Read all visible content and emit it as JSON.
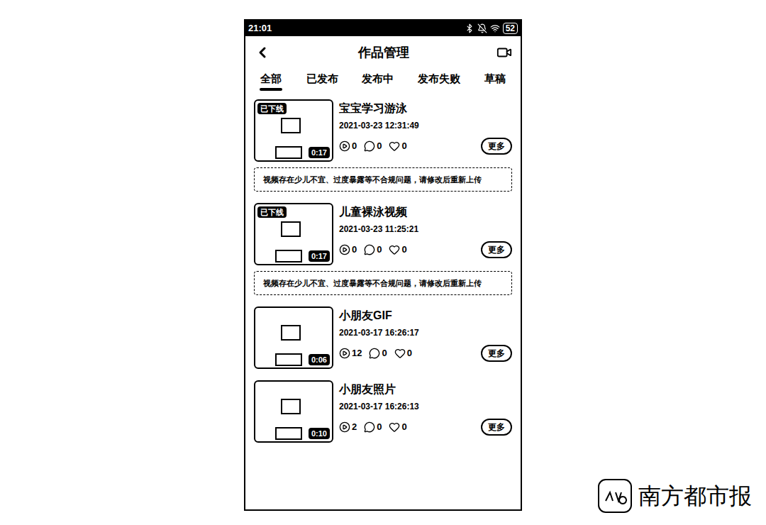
{
  "status_bar": {
    "time": "21:01",
    "battery": "52"
  },
  "header": {
    "title": "作品管理"
  },
  "tabs": [
    {
      "label": "全部",
      "selected": true
    },
    {
      "label": "已发布",
      "selected": false
    },
    {
      "label": "发布中",
      "selected": false
    },
    {
      "label": "发布失败",
      "selected": false
    },
    {
      "label": "草稿",
      "selected": false
    }
  ],
  "works": [
    {
      "title": "宝宝学习游泳",
      "date": "2021-03-23 12:31:49",
      "duration": "0:17",
      "offline": true,
      "badge": "已下线",
      "stats": {
        "plays": "0",
        "comments": "0",
        "likes": "0"
      },
      "more": "更多",
      "notice": "视频存在少儿不宜、过度暴露等不合规问题，请修改后重新上传"
    },
    {
      "title": "儿童裸泳视频",
      "date": "2021-03-23 11:25:21",
      "duration": "0:17",
      "offline": true,
      "badge": "已下线",
      "stats": {
        "plays": "0",
        "comments": "0",
        "likes": "0"
      },
      "more": "更多",
      "notice": "视频存在少儿不宜、过度暴露等不合规问题，请修改后重新上传"
    },
    {
      "title": "小朋友GIF",
      "date": "2021-03-17 16:26:17",
      "duration": "0:06",
      "offline": false,
      "stats": {
        "plays": "12",
        "comments": "0",
        "likes": "0"
      },
      "more": "更多"
    },
    {
      "title": "小朋友照片",
      "date": "2021-03-17 16:26:13",
      "duration": "0:10",
      "offline": false,
      "stats": {
        "plays": "2",
        "comments": "0",
        "likes": "0"
      },
      "more": "更多"
    }
  ],
  "watermark": {
    "text": "南方都市报"
  }
}
